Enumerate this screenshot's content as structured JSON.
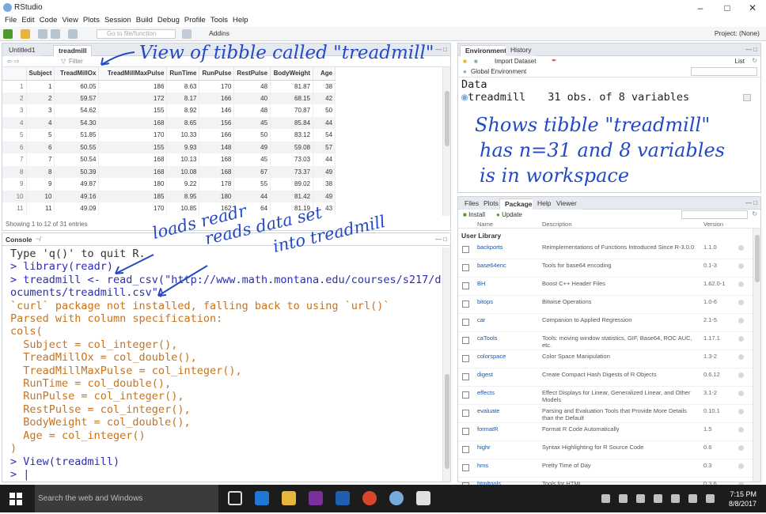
{
  "window": {
    "title": "RStudio"
  },
  "menu": [
    "File",
    "Edit",
    "Code",
    "View",
    "Plots",
    "Session",
    "Build",
    "Debug",
    "Profile",
    "Tools",
    "Help"
  ],
  "toolbar": {
    "goto_placeholder": "Go to file/function",
    "addins": "Addins",
    "project": "Project: (None)"
  },
  "source_pane": {
    "tabs": [
      "Untitled1",
      "treadmill"
    ],
    "filter": "Filter",
    "columns": [
      "",
      "Subject",
      "TreadMillOx",
      "TreadMillMaxPulse",
      "RunTime",
      "RunPulse",
      "RestPulse",
      "BodyWeight",
      "Age"
    ],
    "rows": [
      [
        "1",
        "1",
        "60.05",
        "186",
        "8.63",
        "170",
        "48",
        "81.87",
        "38"
      ],
      [
        "2",
        "2",
        "59.57",
        "172",
        "8.17",
        "166",
        "40",
        "68.15",
        "42"
      ],
      [
        "3",
        "3",
        "54.62",
        "155",
        "8.92",
        "146",
        "48",
        "70.87",
        "50"
      ],
      [
        "4",
        "4",
        "54.30",
        "168",
        "8.65",
        "156",
        "45",
        "85.84",
        "44"
      ],
      [
        "5",
        "5",
        "51.85",
        "170",
        "10.33",
        "166",
        "50",
        "83.12",
        "54"
      ],
      [
        "6",
        "6",
        "50.55",
        "155",
        "9.93",
        "148",
        "49",
        "59.08",
        "57"
      ],
      [
        "7",
        "7",
        "50.54",
        "168",
        "10.13",
        "168",
        "45",
        "73.03",
        "44"
      ],
      [
        "8",
        "8",
        "50.39",
        "168",
        "10.08",
        "168",
        "67",
        "73.37",
        "49"
      ],
      [
        "9",
        "9",
        "49.87",
        "180",
        "9.22",
        "178",
        "55",
        "89.02",
        "38"
      ],
      [
        "10",
        "10",
        "49.16",
        "185",
        "8.95",
        "180",
        "44",
        "81.42",
        "49"
      ],
      [
        "11",
        "11",
        "49.09",
        "170",
        "10.85",
        "162",
        "64",
        "81.19",
        "43"
      ]
    ],
    "status": "Showing 1 to 12 of 31 entries"
  },
  "console": {
    "tab": "Console",
    "path": "~/",
    "lines": [
      {
        "t": "Type 'q()' to quit R.",
        "c": "out0"
      },
      {
        "t": "",
        "c": "in"
      },
      {
        "t": "> library(readr)",
        "c": "in"
      },
      {
        "t": "> treadmill <- read_csv(\"http://www.math.montana.edu/courses/s217/d",
        "c": "in"
      },
      {
        "t": "ocuments/treadmill.csv\")",
        "c": "in"
      },
      {
        "t": "`curl` package not installed, falling back to using `url()`",
        "c": "out"
      },
      {
        "t": "Parsed with column specification:",
        "c": "out"
      },
      {
        "t": "cols(",
        "c": "out"
      },
      {
        "t": "  Subject = col_integer(),",
        "c": "out"
      },
      {
        "t": "  TreadMillOx = col_double(),",
        "c": "out"
      },
      {
        "t": "  TreadMillMaxPulse = col_integer(),",
        "c": "out"
      },
      {
        "t": "  RunTime = col_double(),",
        "c": "out"
      },
      {
        "t": "  RunPulse = col_integer(),",
        "c": "out"
      },
      {
        "t": "  RestPulse = col_integer(),",
        "c": "out"
      },
      {
        "t": "  BodyWeight = col_double(),",
        "c": "out"
      },
      {
        "t": "  Age = col_integer()",
        "c": "out"
      },
      {
        "t": ")",
        "c": "out"
      },
      {
        "t": "> View(treadmill)",
        "c": "in"
      },
      {
        "t": "> |",
        "c": "in"
      }
    ]
  },
  "environment": {
    "tabs": [
      "Environment",
      "History"
    ],
    "import": "Import Dataset",
    "list_mode": "List",
    "scope": "Global Environment",
    "section": "Data",
    "object_name": "treadmill",
    "object_desc": "31 obs. of 8 variables"
  },
  "packages_pane": {
    "tabs": [
      "Files",
      "Plots",
      "Packages",
      "Help",
      "Viewer"
    ],
    "install": "Install",
    "update": "Update",
    "headers": [
      "Name",
      "Description",
      "Version"
    ],
    "library": "User Library",
    "packages": [
      {
        "name": "backports",
        "desc": "Reimplementations of Functions Introduced Since R-3.0.0",
        "ver": "1.1.0"
      },
      {
        "name": "base64enc",
        "desc": "Tools for base64 encoding",
        "ver": "0.1-3"
      },
      {
        "name": "BH",
        "desc": "Boost C++ Header Files",
        "ver": "1.62.0-1"
      },
      {
        "name": "bitops",
        "desc": "Bitwise Operations",
        "ver": "1.0-6"
      },
      {
        "name": "car",
        "desc": "Companion to Applied Regression",
        "ver": "2.1-5"
      },
      {
        "name": "caTools",
        "desc": "Tools: moving window statistics, GIF, Base64, ROC AUC, etc.",
        "ver": "1.17.1"
      },
      {
        "name": "colorspace",
        "desc": "Color Space Manipulation",
        "ver": "1.3-2"
      },
      {
        "name": "digest",
        "desc": "Create Compact Hash Digests of R Objects",
        "ver": "0.6.12"
      },
      {
        "name": "effects",
        "desc": "Effect Displays for Linear, Generalized Linear, and Other Models",
        "ver": "3.1-2"
      },
      {
        "name": "evaluate",
        "desc": "Parsing and Evaluation Tools that Provide More Details than the Default",
        "ver": "0.10.1"
      },
      {
        "name": "formatR",
        "desc": "Format R Code Automatically",
        "ver": "1.5"
      },
      {
        "name": "highr",
        "desc": "Syntax Highlighting for R Source Code",
        "ver": "0.6"
      },
      {
        "name": "hms",
        "desc": "Pretty Time of Day",
        "ver": "0.3"
      },
      {
        "name": "htmltools",
        "desc": "Tools for HTML",
        "ver": "0.3.6"
      },
      {
        "name": "jsonlite",
        "desc": "A Robust, High Performance JSON Parser and Generator",
        "ver": "1.5"
      }
    ]
  },
  "annotations": {
    "view": "View of tibble called \"treadmill\"",
    "loads": "loads readr",
    "reads1": "reads data set",
    "reads2": "into treadmill",
    "shows1": "Shows tibble \"treadmill\"",
    "shows2": "has n=31 and 8 variables",
    "shows3": "is in workspace"
  },
  "taskbar": {
    "search": "Search the web and Windows",
    "time": "7:15 PM",
    "date": "8/8/2017"
  },
  "colors": {
    "accent": "#75aadb",
    "input": "#2c2cb8",
    "output": "#c8731e",
    "ink": "#2349c4"
  }
}
